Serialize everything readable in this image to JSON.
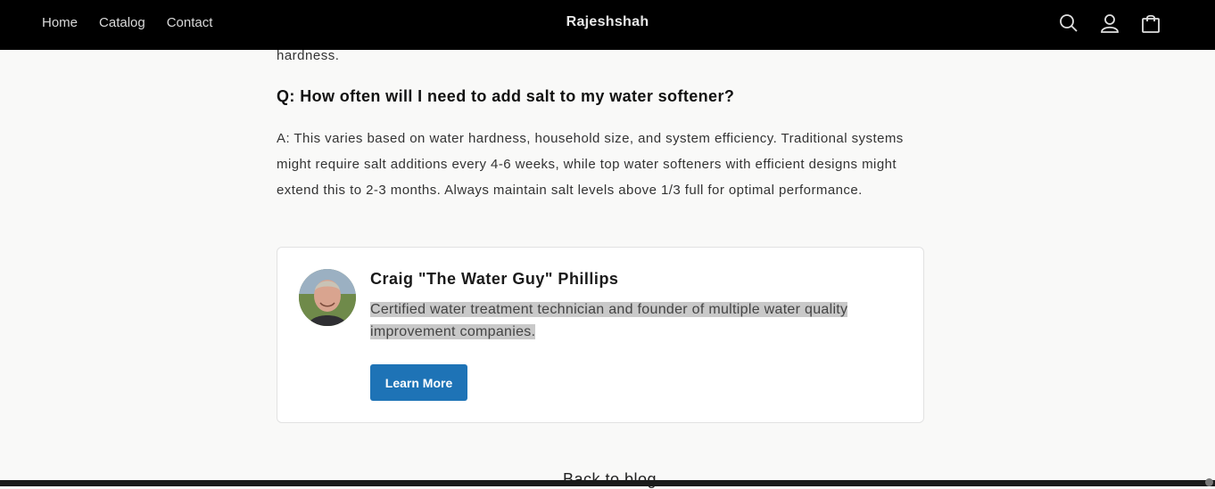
{
  "header": {
    "brand": "Rajeshshah",
    "nav": [
      "Home",
      "Catalog",
      "Contact"
    ],
    "icons": [
      "search-icon",
      "account-icon",
      "cart-icon"
    ]
  },
  "article": {
    "prev_text": "hardness.",
    "question": "Q: How often will I need to add salt to my water softener?",
    "answer": "A: This varies based on water hardness, household size, and system efficiency. Traditional systems might require salt additions every 4-6 weeks, while top water softeners with efficient designs might extend this to 2-3 months. Always maintain salt levels above 1/3 full for optimal performance."
  },
  "author": {
    "name": "Craig \"The Water Guy\" Phillips",
    "bio": "Certified water treatment technician and founder of multiple water quality improvement companies.",
    "button_label": "Learn More"
  },
  "footer": {
    "back_link": "← Back to blog"
  },
  "colors": {
    "header_bg": "#000000",
    "page_bg": "#f9f9f8",
    "button_bg": "#1e73b6",
    "selection": "#c9c9c9"
  }
}
